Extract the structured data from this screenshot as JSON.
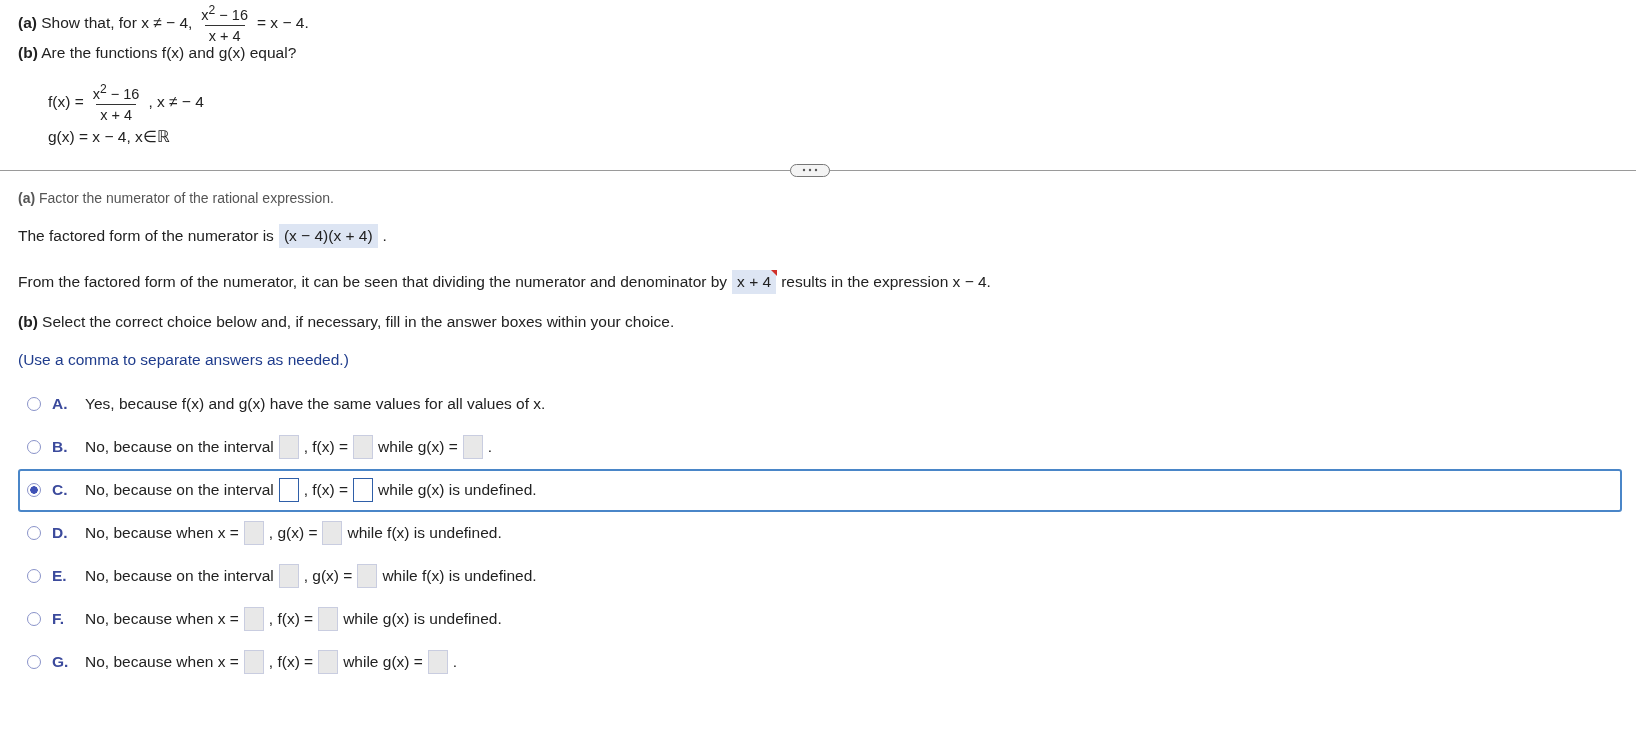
{
  "question": {
    "part_a": {
      "text": "**(a)** Show that, for x ≠ − 4,",
      "fraction": {
        "numerator": "x$^{2}$ − 16",
        "denominator": "x + 4"
      },
      "tail": "= x − 4."
    },
    "part_b": "**(b)** Are the functions f(x) and g(x) equal?",
    "f_def": {
      "lhs": "f(x) =",
      "fraction": {
        "numerator": "x$^{2}$ − 16",
        "denominator": "x + 4"
      },
      "tail": ", x ≠ − 4"
    },
    "g_def": "g(x) = x − 4, x∈ℝ"
  },
  "solution": {
    "partial_line": "**(a)** Factor the numerator of the rational expression.",
    "factored": {
      "text": "The factored form of the numerator is",
      "answer": "(x − 4)(x + 4)",
      "end": "."
    },
    "dividing": {
      "text": "From the factored form of the numerator, it can be seen that dividing the numerator and denominator by",
      "answer": "x + 4",
      "flagged": true,
      "tail": "results in the expression x − 4."
    },
    "part_b_prompt": "**(b)** Select the correct choice below and, if necessary, fill in the answer boxes within your choice.",
    "hint": "(Use a comma to separate answers as needed.)",
    "choices": [
      {
        "letter": "A.",
        "selected": false,
        "parts": [
          {
            "kind": "text",
            "text": "Yes, because f(x) and g(x) have the same values for all values of x."
          }
        ]
      },
      {
        "letter": "B.",
        "selected": false,
        "parts": [
          {
            "kind": "text",
            "text": "No, because on the interval"
          },
          {
            "kind": "box"
          },
          {
            "kind": "text",
            "text": ", f(x) ="
          },
          {
            "kind": "box"
          },
          {
            "kind": "text",
            "text": "while g(x) ="
          },
          {
            "kind": "box"
          },
          {
            "kind": "text",
            "text": "."
          }
        ]
      },
      {
        "letter": "C.",
        "selected": true,
        "parts": [
          {
            "kind": "text",
            "text": "No, because on the interval"
          },
          {
            "kind": "box"
          },
          {
            "kind": "text",
            "text": ", f(x) ="
          },
          {
            "kind": "box"
          },
          {
            "kind": "text",
            "text": "while g(x) is undefined."
          }
        ]
      },
      {
        "letter": "D.",
        "selected": false,
        "parts": [
          {
            "kind": "text",
            "text": "No, because when x ="
          },
          {
            "kind": "box"
          },
          {
            "kind": "text",
            "text": ", g(x) ="
          },
          {
            "kind": "box"
          },
          {
            "kind": "text",
            "text": "while f(x) is undefined."
          }
        ]
      },
      {
        "letter": "E.",
        "selected": false,
        "parts": [
          {
            "kind": "text",
            "text": "No, because on the interval"
          },
          {
            "kind": "box"
          },
          {
            "kind": "text",
            "text": ", g(x) ="
          },
          {
            "kind": "box"
          },
          {
            "kind": "text",
            "text": "while f(x) is undefined."
          }
        ]
      },
      {
        "letter": "F.",
        "selected": false,
        "parts": [
          {
            "kind": "text",
            "text": "No, because when x ="
          },
          {
            "kind": "box"
          },
          {
            "kind": "text",
            "text": ", f(x) ="
          },
          {
            "kind": "box"
          },
          {
            "kind": "text",
            "text": "while g(x) is undefined."
          }
        ]
      },
      {
        "letter": "G.",
        "selected": false,
        "parts": [
          {
            "kind": "text",
            "text": "No, because when x ="
          },
          {
            "kind": "box"
          },
          {
            "kind": "text",
            "text": ", f(x) ="
          },
          {
            "kind": "box"
          },
          {
            "kind": "text",
            "text": "while g(x) ="
          },
          {
            "kind": "box"
          },
          {
            "kind": "text",
            "text": "."
          }
        ]
      }
    ]
  }
}
